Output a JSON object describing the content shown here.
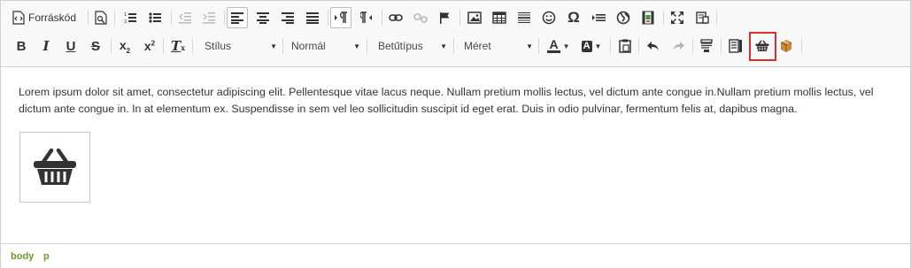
{
  "toolbar": {
    "source_label": "Forráskód",
    "format_styles": {
      "label": "Stílus",
      "arrow": "▼"
    },
    "format_block": {
      "label": "Normál",
      "arrow": "▼"
    },
    "font_family": {
      "label": "Betűtípus",
      "arrow": "▼"
    },
    "font_size": {
      "label": "Méret",
      "arrow": "▼"
    },
    "text_color_letter": "A",
    "bg_color_letter": "A",
    "bold": "B",
    "italic": "I",
    "underline": "U",
    "strike": "S",
    "subscript": {
      "base": "x",
      "mark": "2"
    },
    "superscript": {
      "base": "x",
      "mark": "2"
    },
    "remove_format": "T",
    "special_char": "Ω",
    "colors": {
      "accent_highlight": "#d9302f",
      "breadcrumb": "#6a9c2c"
    }
  },
  "content": {
    "paragraph": "Lorem ipsum dolor sit amet, consectetur adipiscing elit. Pellentesque vitae lacus neque. Nullam pretium mollis lectus, vel dictum ante congue in.Nullam pretium mollis lectus, vel dictum ante congue in. In at elementum ex. Suspendisse in sem vel leo sollicitudin suscipit id eget erat. Duis in odio pulvinar, fermentum felis at, dapibus magna."
  },
  "statusbar": {
    "path": [
      "body",
      "p"
    ]
  }
}
